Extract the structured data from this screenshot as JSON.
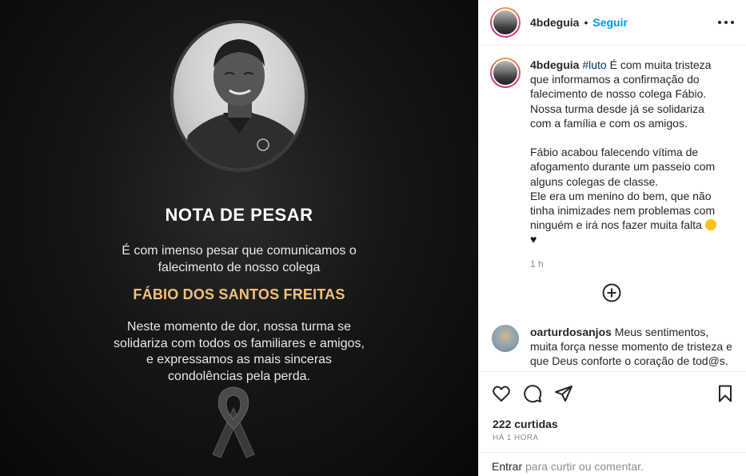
{
  "post_image": {
    "title": "NOTA DE PESAR",
    "paragraph1": "É com imenso pesar que comunicamos o falecimento de nosso colega",
    "name": "FÁBIO DOS SANTOS FREITAS",
    "paragraph2": "Neste momento de dor, nossa turma se solidariza com todos os familiares e amigos, e expressamos as mais sinceras condolências pela perda."
  },
  "header": {
    "username": "4bdeguia",
    "separator": "•",
    "follow_label": "Seguir"
  },
  "caption": {
    "username": "4bdeguia",
    "hashtag": "#luto",
    "text1": "É com muita tristeza que informamos a confirmação do falecimento de nosso colega Fábio. Nossa turma desde já se solidariza com a família e com os amigos.",
    "text2": "Fábio acabou falecendo vítima de afogamento durante um passeio com alguns colegas de classe.",
    "text3": "Ele era um menino do bem, que não tinha inimizades nem problemas com ninguém e irá nos fazer muita falta",
    "time": "1 h"
  },
  "comment": {
    "username": "oarturdosanjos",
    "text": "Meus sentimentos, muita força nesse momento de tristeza e que Deus conforte o coração de tod@s."
  },
  "footer": {
    "likes": "222 curtidas",
    "posted_ago": "HÁ 1 HORA",
    "login_link": "Entrar",
    "add_comment_hint": "para curtir ou comentar."
  },
  "colors": {
    "follow_blue": "#0095f6",
    "hashtag": "#00376b",
    "name_gold": "#f0c27a",
    "muted": "#8e8e8e"
  },
  "icons": [
    "more-options-icon",
    "load-more-comments-icon",
    "heart-icon",
    "comment-icon",
    "share-icon",
    "bookmark-icon",
    "black-ribbon-icon"
  ]
}
